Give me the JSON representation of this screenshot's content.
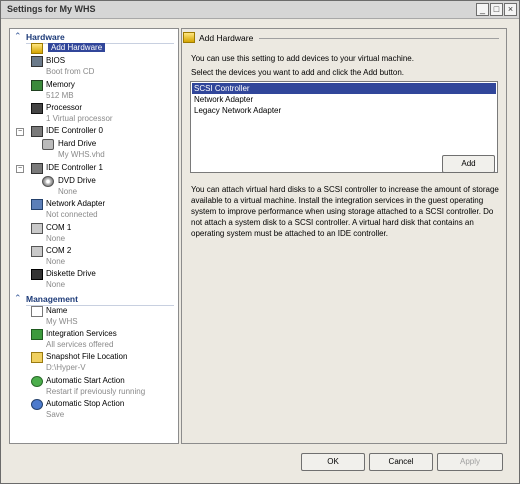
{
  "window": {
    "title": "Settings for My WHS"
  },
  "tree": {
    "hardware_header": "Hardware",
    "management_header": "Management",
    "hardware_items": [
      {
        "label": "Add Hardware",
        "sub": ""
      },
      {
        "label": "BIOS",
        "sub": "Boot from CD"
      },
      {
        "label": "Memory",
        "sub": "512 MB"
      },
      {
        "label": "Processor",
        "sub": "1 Virtual processor"
      },
      {
        "label": "IDE Controller 0",
        "sub": ""
      },
      {
        "label": "Hard Drive",
        "sub": "My WHS.vhd"
      },
      {
        "label": "IDE Controller 1",
        "sub": ""
      },
      {
        "label": "DVD Drive",
        "sub": "None"
      },
      {
        "label": "Network Adapter",
        "sub": "Not connected"
      },
      {
        "label": "COM 1",
        "sub": "None"
      },
      {
        "label": "COM 2",
        "sub": "None"
      },
      {
        "label": "Diskette Drive",
        "sub": "None"
      }
    ],
    "management_items": [
      {
        "label": "Name",
        "sub": "My WHS"
      },
      {
        "label": "Integration Services",
        "sub": "All services offered"
      },
      {
        "label": "Snapshot File Location",
        "sub": "D:\\Hyper-V"
      },
      {
        "label": "Automatic Start Action",
        "sub": "Restart if previously running"
      },
      {
        "label": "Automatic Stop Action",
        "sub": "Save"
      }
    ]
  },
  "panel": {
    "header": "Add Hardware",
    "intro": "You can use this setting to add devices to your virtual machine.",
    "instruction": "Select the devices you want to add and click the Add button.",
    "devices": [
      "SCSI Controller",
      "Network Adapter",
      "Legacy Network Adapter"
    ],
    "selected_device": "SCSI Controller",
    "add_label": "Add",
    "description": "You can attach virtual hard disks to a SCSI controller to increase the amount of storage available to a virtual machine. Install the integration services in the guest operating system to improve performance when using storage attached to a SCSI controller. Do not attach a system disk to a SCSI controller. A virtual hard disk that contains an operating system must be attached to an IDE controller."
  },
  "buttons": {
    "ok": "OK",
    "cancel": "Cancel",
    "apply": "Apply"
  },
  "colors": {
    "selection": "#31469a",
    "section_header": "#1c3a78"
  }
}
